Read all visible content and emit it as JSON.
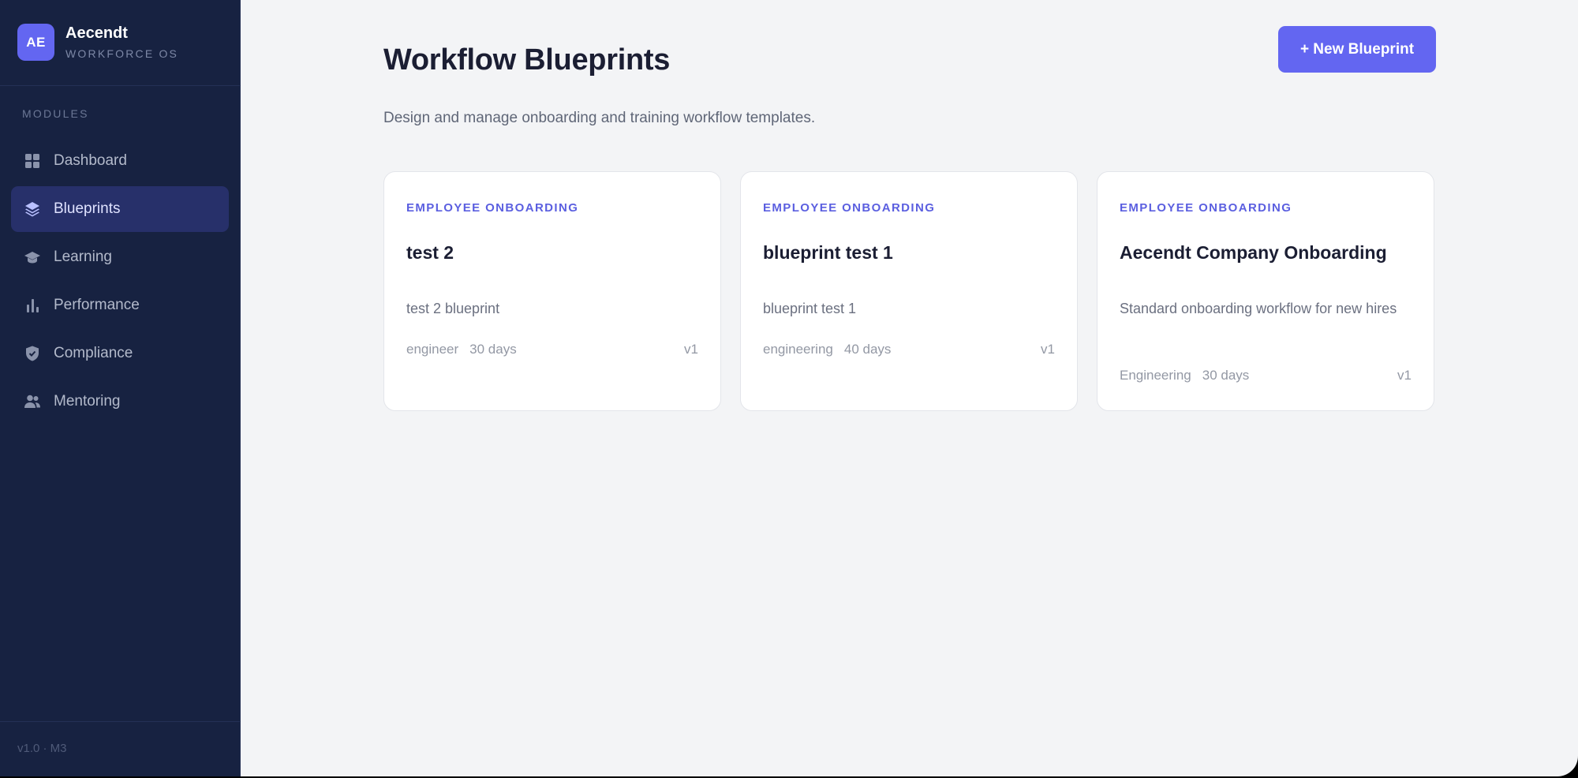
{
  "brand": {
    "initials": "AE",
    "name": "Aecendt",
    "subtitle": "WORKFORCE OS"
  },
  "sidebar": {
    "section_label": "MODULES",
    "items": [
      {
        "label": "Dashboard",
        "icon": "grid-icon",
        "active": false
      },
      {
        "label": "Blueprints",
        "icon": "layers-icon",
        "active": true
      },
      {
        "label": "Learning",
        "icon": "graduation-cap-icon",
        "active": false
      },
      {
        "label": "Performance",
        "icon": "bar-chart-icon",
        "active": false
      },
      {
        "label": "Compliance",
        "icon": "shield-icon",
        "active": false
      },
      {
        "label": "Mentoring",
        "icon": "users-icon",
        "active": false
      }
    ],
    "version": "v1.0 · M3"
  },
  "page": {
    "title": "Workflow Blueprints",
    "subtitle": "Design and manage onboarding and training workflow templates.",
    "new_button": "+ New Blueprint"
  },
  "cards": [
    {
      "category": "EMPLOYEE ONBOARDING",
      "title": "test 2",
      "description": "test 2 blueprint",
      "department": "engineer",
      "duration": "30 days",
      "version": "v1"
    },
    {
      "category": "EMPLOYEE ONBOARDING",
      "title": "blueprint test 1",
      "description": "blueprint test 1",
      "department": "engineering",
      "duration": "40 days",
      "version": "v1"
    },
    {
      "category": "EMPLOYEE ONBOARDING",
      "title": "Aecendt Company Onboarding",
      "description": "Standard onboarding workflow for new hires",
      "department": "Engineering",
      "duration": "30 days",
      "version": "v1"
    }
  ],
  "colors": {
    "accent": "#6366f1",
    "sidebar_bg": "#172241",
    "page_bg": "#f3f4f6"
  }
}
